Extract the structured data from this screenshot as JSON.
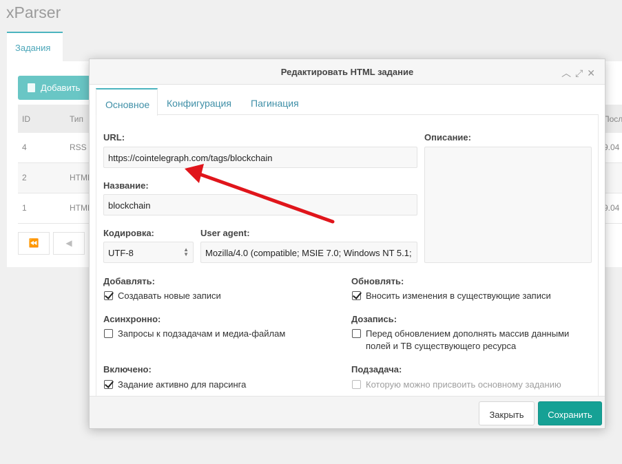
{
  "app": {
    "title": "xParser"
  },
  "background": {
    "tab_label": "Задания",
    "add_button_label": "Добавить",
    "table": {
      "headers": {
        "id": "ID",
        "type": "Тип",
        "last": "Посл"
      },
      "rows": [
        {
          "id": "4",
          "type": "RSS",
          "last": "9.04"
        },
        {
          "id": "2",
          "type": "HTML",
          "last": ""
        },
        {
          "id": "1",
          "type": "HTML",
          "last": "9.04"
        }
      ]
    },
    "pagination": {
      "first": "⏪",
      "prev": "◀"
    }
  },
  "modal": {
    "title": "Редактировать HTML задание",
    "header_icons": {
      "collapse": "chevron-up-icon",
      "expand": "expand-icon",
      "close": "close-icon"
    },
    "tabs": [
      {
        "label": "Основное"
      },
      {
        "label": "Конфигурация"
      },
      {
        "label": "Пагинация"
      }
    ],
    "fields": {
      "url_label": "URL:",
      "url_value": "https://cointelegraph.com/tags/blockchain",
      "name_label": "Название:",
      "name_value": "blockchain",
      "encoding_label": "Кодировка:",
      "encoding_value": "UTF-8",
      "useragent_label": "User agent:",
      "useragent_value": "Mozilla/4.0 (compatible; MSIE 7.0; Windows NT 5.1;",
      "description_label": "Описание:"
    },
    "options": {
      "add_label": "Добавлять:",
      "add_checkbox": {
        "label": "Создавать новые записи",
        "checked": true
      },
      "update_label": "Обновлять:",
      "update_checkbox": {
        "label": "Вносить изменения в существующие записи",
        "checked": true
      },
      "async_label": "Асинхронно:",
      "async_checkbox": {
        "label": "Запросы к подзадачам и медиа-файлам",
        "checked": false
      },
      "append_label": "Дозапись:",
      "append_checkbox": {
        "label_line1": "Перед обновлением дополнять массив данными",
        "label_line2": "полей и ТВ существующего ресурса",
        "checked": false
      },
      "enabled_label": "Включено:",
      "enabled_checkbox": {
        "label": "Задание активно для парсинга",
        "checked": true
      },
      "subtask_label": "Подзадача:",
      "subtask_checkbox": {
        "label": "Которую можно присвоить основному заданию",
        "checked": false,
        "disabled": true
      }
    },
    "buttons": {
      "close": "Закрыть",
      "save": "Сохранить"
    }
  },
  "colors": {
    "accent": "#4bb4bf",
    "save_button": "#16a195",
    "annotation_arrow": "#e0151b"
  }
}
